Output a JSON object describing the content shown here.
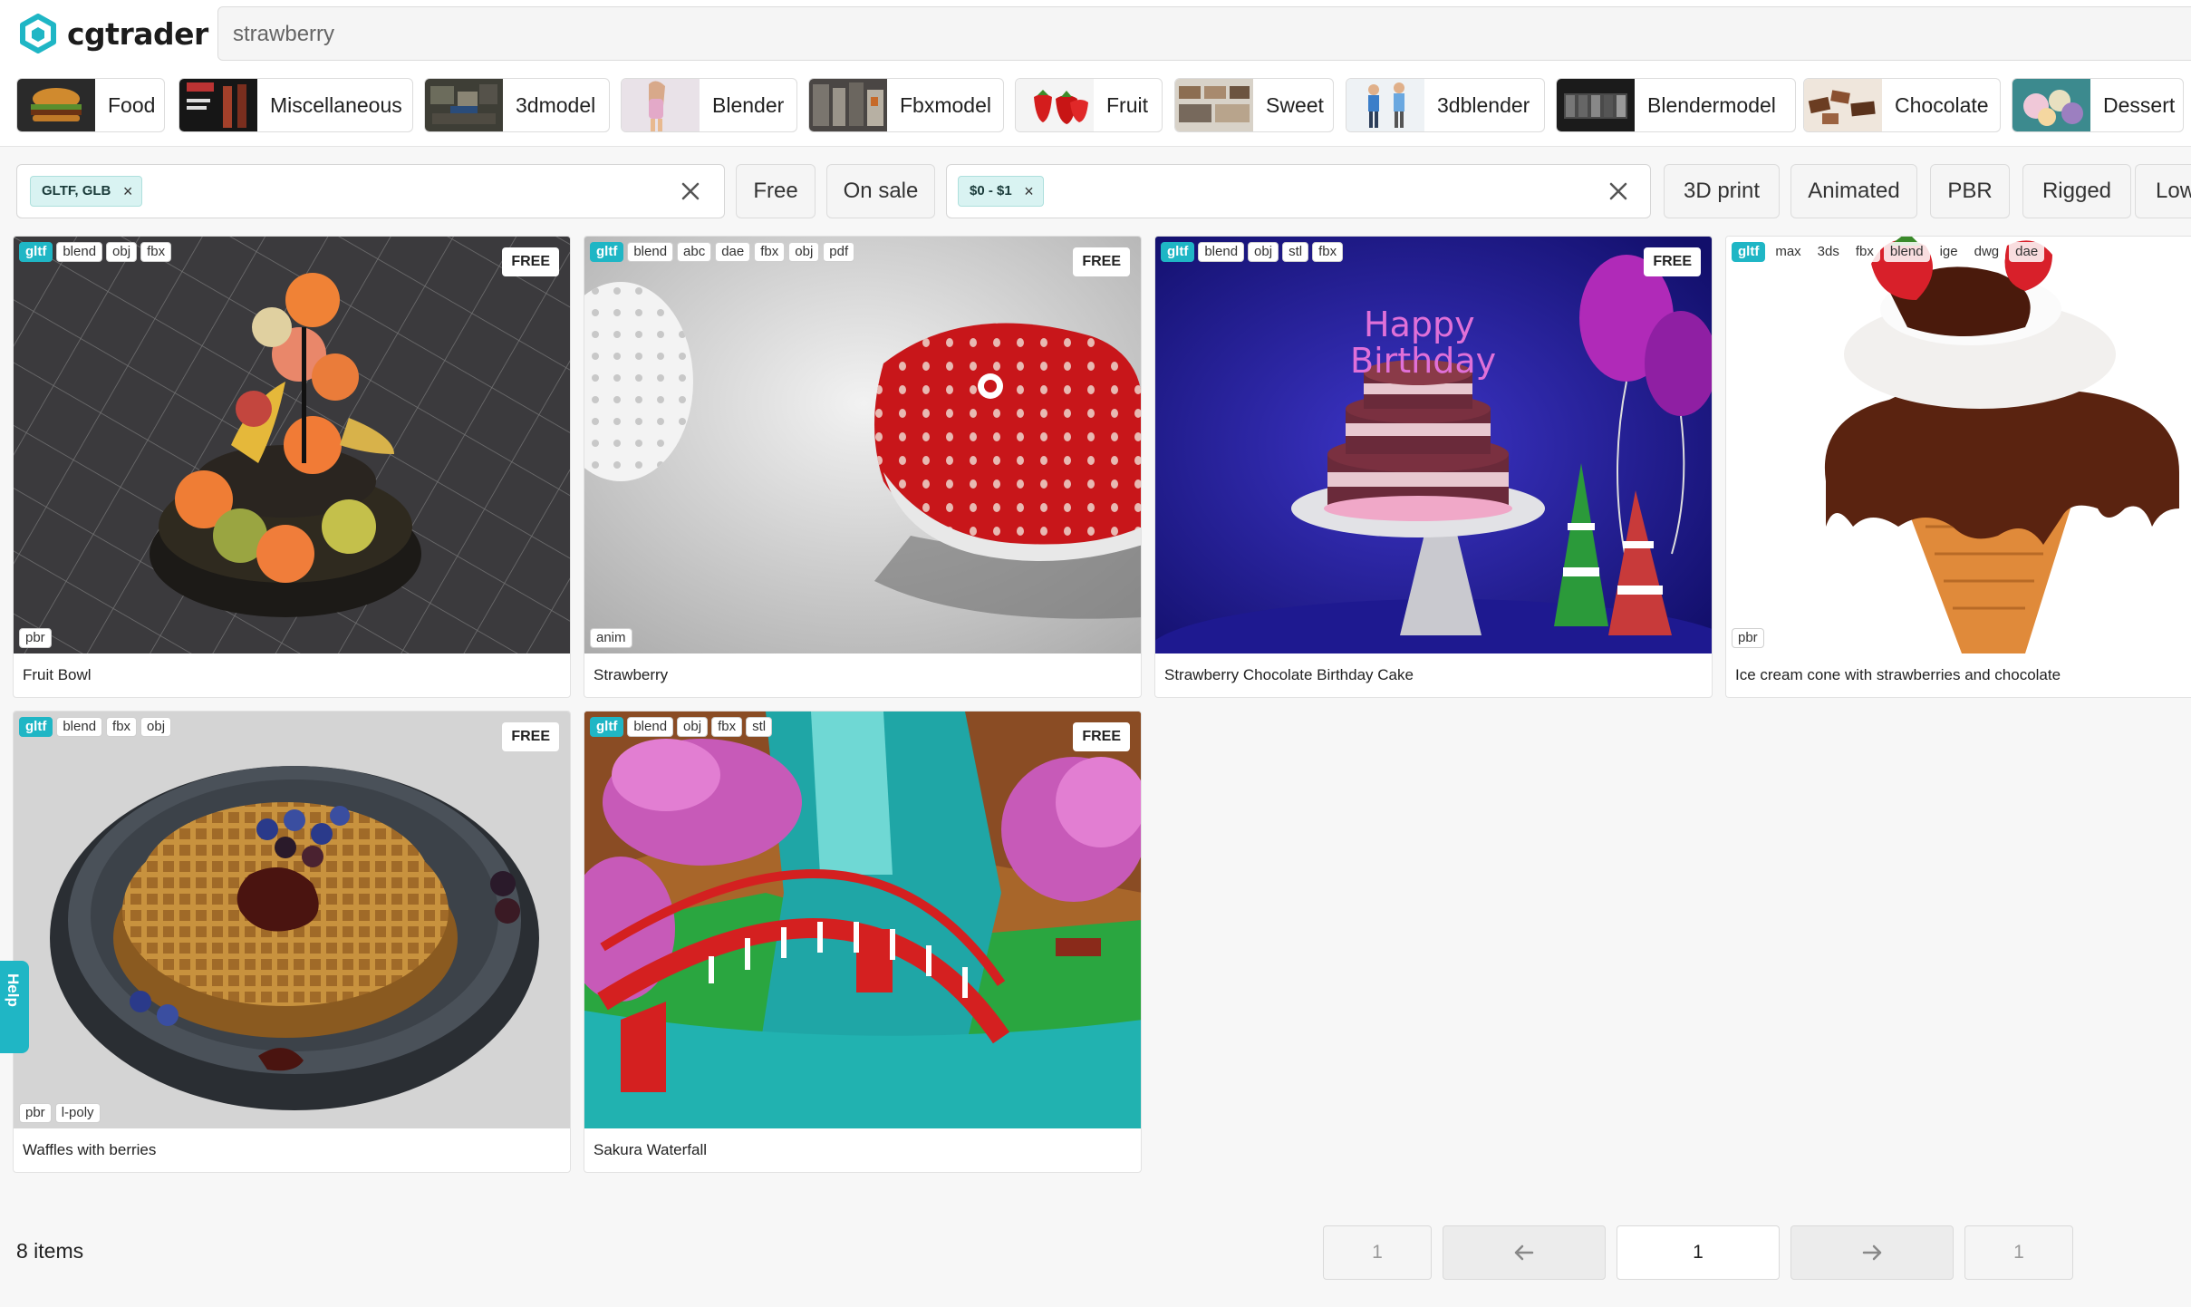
{
  "header": {
    "logo_text": "cgtrader",
    "search_value": "strawberry"
  },
  "categories": [
    {
      "label": "Food"
    },
    {
      "label": "Miscellaneous"
    },
    {
      "label": "3dmodel"
    },
    {
      "label": "Blender"
    },
    {
      "label": "Fbxmodel"
    },
    {
      "label": "Fruit"
    },
    {
      "label": "Sweet"
    },
    {
      "label": "3dblender"
    },
    {
      "label": "Blendermodel"
    },
    {
      "label": "Chocolate"
    },
    {
      "label": "Dessert"
    }
  ],
  "filters": {
    "format_chip": "GLTF, GLB",
    "free": "Free",
    "on_sale": "On sale",
    "price_chip": "$0 - $1",
    "print3d": "3D print",
    "animated": "Animated",
    "pbr": "PBR",
    "rigged": "Rigged",
    "lowpoly": "Low"
  },
  "products": [
    {
      "title": "Fruit Bowl",
      "formats": [
        "gltf",
        "blend",
        "obj",
        "fbx"
      ],
      "badge": "FREE",
      "tags": [
        "pbr"
      ]
    },
    {
      "title": "Strawberry",
      "formats": [
        "gltf",
        "blend",
        "abc",
        "dae",
        "fbx",
        "obj",
        "pdf"
      ],
      "badge": "FREE",
      "tags": [
        "anim"
      ]
    },
    {
      "title": "Strawberry Chocolate Birthday Cake",
      "formats": [
        "gltf",
        "blend",
        "obj",
        "stl",
        "fbx"
      ],
      "badge": "FREE",
      "tags": [],
      "cake_text_1": "Happy",
      "cake_text_2": "Birthday"
    },
    {
      "title": "Ice cream cone with strawberries and chocolate",
      "formats": [
        "gltf",
        "max",
        "3ds",
        "fbx",
        "blend",
        "ige",
        "dwg",
        "dae"
      ],
      "badge": "",
      "tags": [
        "pbr"
      ]
    },
    {
      "title": "Waffles with berries",
      "formats": [
        "gltf",
        "blend",
        "fbx",
        "obj"
      ],
      "badge": "FREE",
      "tags": [
        "pbr",
        "l-poly"
      ]
    },
    {
      "title": "Sakura Waterfall",
      "formats": [
        "gltf",
        "blend",
        "obj",
        "fbx",
        "stl"
      ],
      "badge": "FREE",
      "tags": []
    }
  ],
  "footer": {
    "items_count": "8 items",
    "first_page": "1",
    "current_page": "1",
    "last_page": "1",
    "prev_icon": "arrow-left-icon",
    "next_icon": "arrow-right-icon"
  },
  "help": {
    "label": "Help"
  },
  "colors": {
    "accent": "#1fb6c5",
    "chip_bg": "#d9f3f2"
  }
}
